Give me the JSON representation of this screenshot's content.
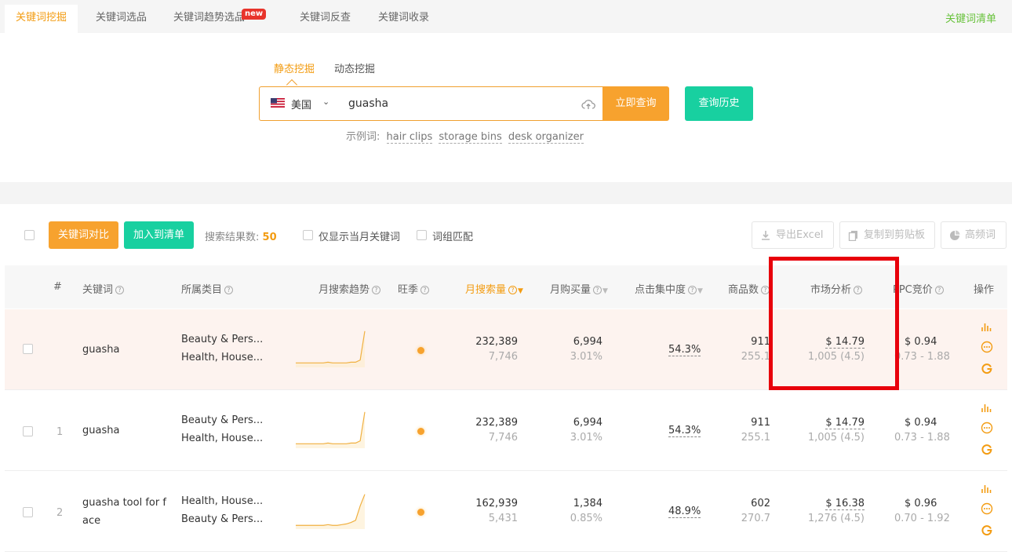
{
  "tabs": [
    "关键词挖掘",
    "关键词选品",
    "关键词趋势选品",
    "关键词反查",
    "关键词收录"
  ],
  "tab_badge": "new",
  "keyword_list_link": "关键词清单",
  "modes": [
    "静态挖掘",
    "动态挖掘"
  ],
  "search": {
    "country": "美国",
    "query": "guasha",
    "submit_label": "立即查询",
    "history_label": "查询历史"
  },
  "examples": {
    "label": "示例词:",
    "words": [
      "hair clips",
      "storage bins",
      "desk organizer"
    ]
  },
  "toolbar": {
    "compare_label": "关键词对比",
    "add_list_label": "加入到清单",
    "result_label": "搜索结果数:",
    "result_count": "50",
    "current_month_label": "仅显示当月关键词",
    "phrase_match_label": "词组匹配",
    "export_label": "导出Excel",
    "copy_label": "复制到剪贴板",
    "frequent_label": "高频词"
  },
  "columns": {
    "index": "#",
    "keyword": "关键词",
    "category": "所属类目",
    "trend": "月搜索趋势",
    "peak": "旺季",
    "monthly_search": "月搜索量",
    "monthly_purchase": "月购买量",
    "click_concentration": "点击集中度",
    "products": "商品数",
    "market": "市场分析",
    "ppc": "PPC竞价",
    "ops": "操作"
  },
  "rows": [
    {
      "index": "",
      "keyword": "guasha",
      "cat1": "Beauty & Pers...",
      "cat2": "Health, House...",
      "search": "232,389",
      "search_sub": "7,746",
      "purchase": "6,994",
      "purchase_sub": "3.01%",
      "click": "54.3%",
      "products": "911",
      "products_sub": "255.1",
      "price": "$ 14.79",
      "reviews": "1,005 (4.5)",
      "ppc": "$ 0.94",
      "ppc_range": "0.73 - 1.88",
      "trend": [
        4,
        4,
        4,
        4,
        4,
        4,
        4,
        5,
        4,
        4,
        4,
        4,
        5,
        5,
        8,
        48
      ]
    },
    {
      "index": "1",
      "keyword": "guasha",
      "cat1": "Beauty & Pers...",
      "cat2": "Health, House...",
      "search": "232,389",
      "search_sub": "7,746",
      "purchase": "6,994",
      "purchase_sub": "3.01%",
      "click": "54.3%",
      "products": "911",
      "products_sub": "255.1",
      "price": "$ 14.79",
      "reviews": "1,005 (4.5)",
      "ppc": "$ 0.94",
      "ppc_range": "0.73 - 1.88",
      "trend": [
        4,
        4,
        4,
        4,
        4,
        4,
        4,
        5,
        4,
        4,
        4,
        4,
        5,
        5,
        8,
        48
      ]
    },
    {
      "index": "2",
      "keyword": "guasha tool for f",
      "keyword2": "ace",
      "cat1": "Health, House...",
      "cat2": "Beauty & Pers...",
      "search": "162,939",
      "search_sub": "5,431",
      "purchase": "1,384",
      "purchase_sub": "0.85%",
      "click": "48.9%",
      "products": "602",
      "products_sub": "270.7",
      "price": "$ 16.38",
      "reviews": "1,276 (4.5)",
      "ppc": "$ 0.96",
      "ppc_range": "0.70 - 1.92",
      "trend": [
        3,
        3,
        3,
        3,
        3,
        3,
        3,
        4,
        3,
        3,
        4,
        5,
        7,
        10,
        30,
        46
      ]
    }
  ],
  "colors": {
    "accent_orange": "#f7a22e",
    "accent_green": "#18d0a0",
    "highlight_box": "#e8000b"
  }
}
